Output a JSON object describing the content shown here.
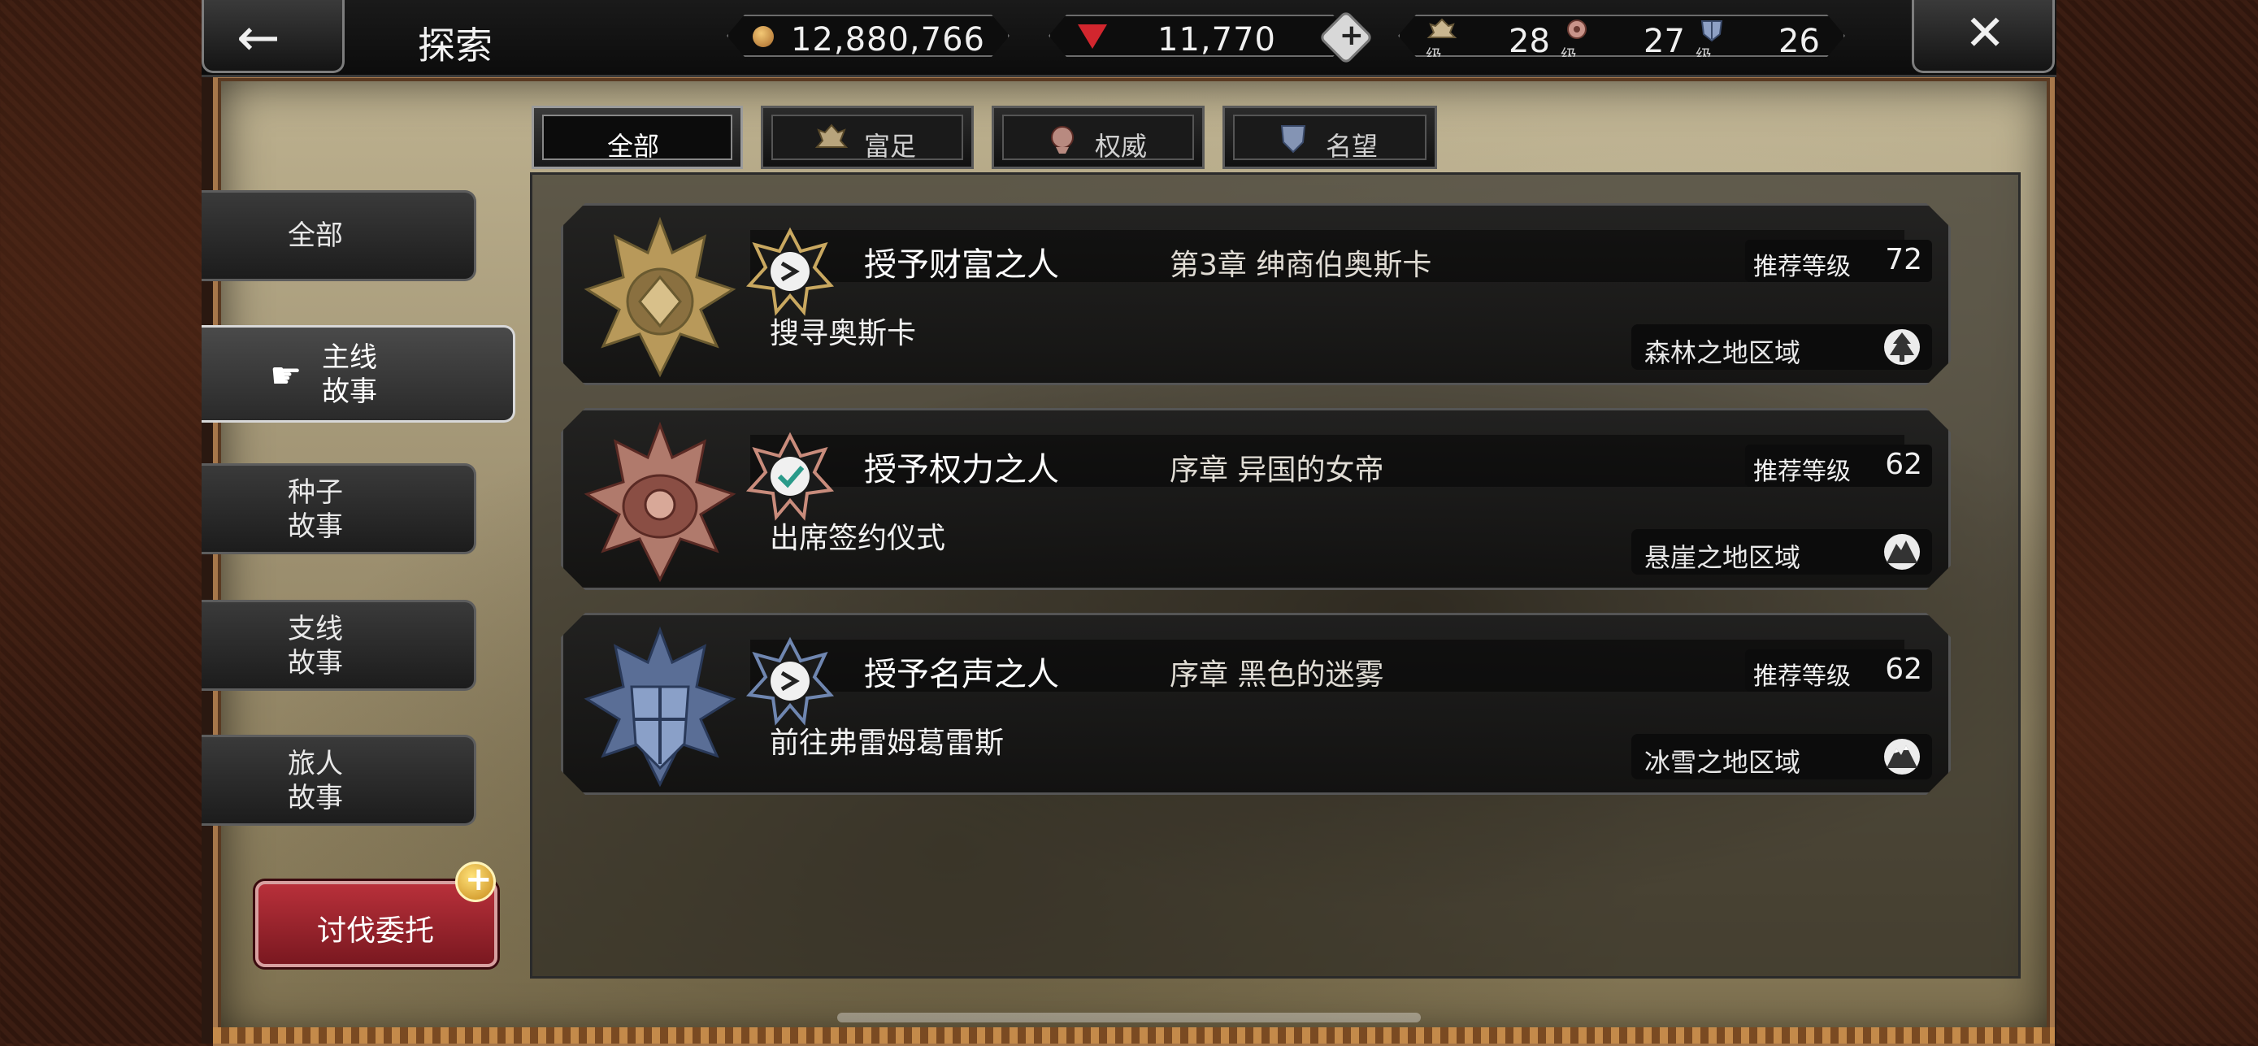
{
  "header": {
    "title": "探索",
    "gold": "12,880,766",
    "gems": "11,770",
    "levels": [
      {
        "icon": "wealth-crest-icon",
        "caption": "级别",
        "value": "28"
      },
      {
        "icon": "authority-crest-icon",
        "caption": "级别",
        "value": "27"
      },
      {
        "icon": "fame-crest-icon",
        "caption": "级别",
        "value": "26"
      }
    ]
  },
  "tabs": [
    {
      "label": "全部",
      "selected": true
    },
    {
      "label": "富足",
      "icon": "wealth-crest-icon"
    },
    {
      "label": "权威",
      "icon": "authority-crest-icon"
    },
    {
      "label": "名望",
      "icon": "fame-crest-icon"
    }
  ],
  "sidebar": {
    "items": [
      {
        "label": "全部"
      },
      {
        "label": "主线\n故事",
        "selected": true
      },
      {
        "label": "种子\n故事"
      },
      {
        "label": "支线\n故事"
      },
      {
        "label": "旅人\n故事"
      }
    ],
    "subjugation_label": "讨伐委托"
  },
  "quests": [
    {
      "title": "授予财富之人",
      "chapter": "第3章  绅商伯奥斯卡",
      "objective": "搜寻奥斯卡",
      "rec_label": "推荐等级",
      "rec_level": "72",
      "region": "森林之地区域",
      "emblem": "wealth-emblem-icon",
      "emblem_color": "#c9a860"
    },
    {
      "title": "授予权力之人",
      "chapter": "序章  异国的女帝",
      "objective": "出席签约仪式",
      "rec_label": "推荐等级",
      "rec_level": "62",
      "region": "悬崖之地区域",
      "emblem": "authority-emblem-icon",
      "emblem_color": "#c98c7c"
    },
    {
      "title": "授予名声之人",
      "chapter": "序章  黑色的迷雾",
      "objective": "前往弗雷姆葛雷斯",
      "rec_label": "推荐等级",
      "rec_level": "62",
      "region": "冰雪之地区域",
      "emblem": "fame-emblem-icon",
      "emblem_color": "#6f86b0"
    }
  ]
}
